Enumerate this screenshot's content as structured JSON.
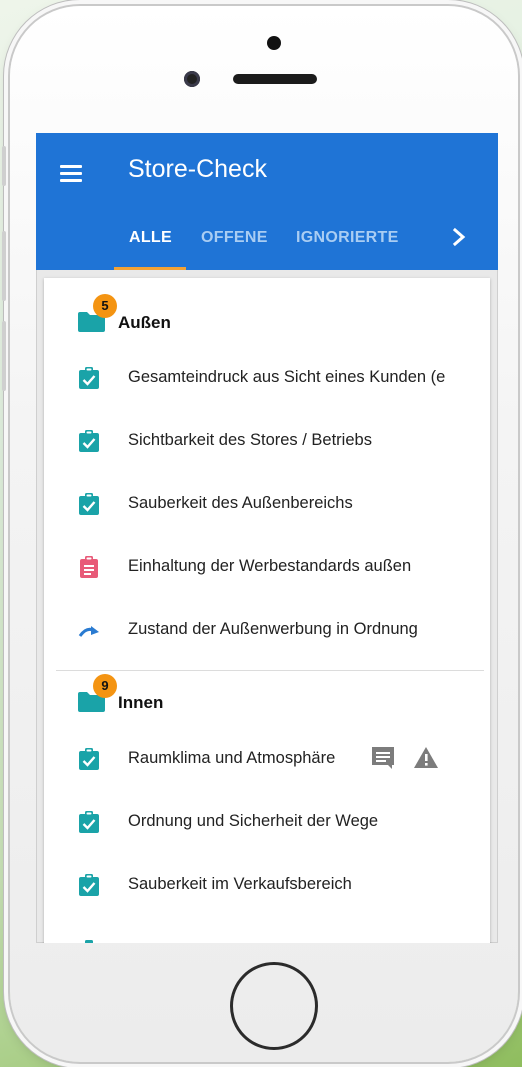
{
  "app": {
    "title": "Store-Check",
    "tabs": [
      {
        "label": "ALLE",
        "active": true
      },
      {
        "label": "OFFENE",
        "active": false
      },
      {
        "label": "IGNORIERTE",
        "active": false
      }
    ]
  },
  "colors": {
    "appbar": "#1f74d6",
    "tab_indicator": "#f3a234",
    "badge": "#f49412",
    "folder_teal": "#1aa3a8",
    "check_teal": "#1aa3a8",
    "open_item_pink": "#e85a78",
    "arrow_blue": "#2a7bd1"
  },
  "sections": [
    {
      "badge": "5",
      "title": "Außen",
      "items": [
        {
          "label": "Gesamteindruck aus Sicht eines Kunden (e",
          "status": "done",
          "icon": "clipboard-check-icon"
        },
        {
          "label": "Sichtbarkeit des Stores / Betriebs",
          "status": "done",
          "icon": "clipboard-check-icon"
        },
        {
          "label": "Sauberkeit des Außenbereichs",
          "status": "done",
          "icon": "clipboard-check-icon"
        },
        {
          "label": "Einhaltung der Werbestandards außen",
          "status": "open",
          "icon": "clipboard-text-icon"
        },
        {
          "label": "Zustand der Außenwerbung in Ordnung",
          "status": "skipped",
          "icon": "redo-arrow-icon"
        }
      ]
    },
    {
      "badge": "9",
      "title": "Innen",
      "items": [
        {
          "label": "Raumklima und Atmosphäre",
          "status": "done",
          "icon": "clipboard-check-icon",
          "extras": [
            "comment-icon",
            "warning-icon"
          ]
        },
        {
          "label": "Ordnung und Sicherheit der Wege",
          "status": "done",
          "icon": "clipboard-check-icon"
        },
        {
          "label": "Sauberkeit im Verkaufsbereich",
          "status": "done",
          "icon": "clipboard-check-icon"
        }
      ]
    }
  ]
}
